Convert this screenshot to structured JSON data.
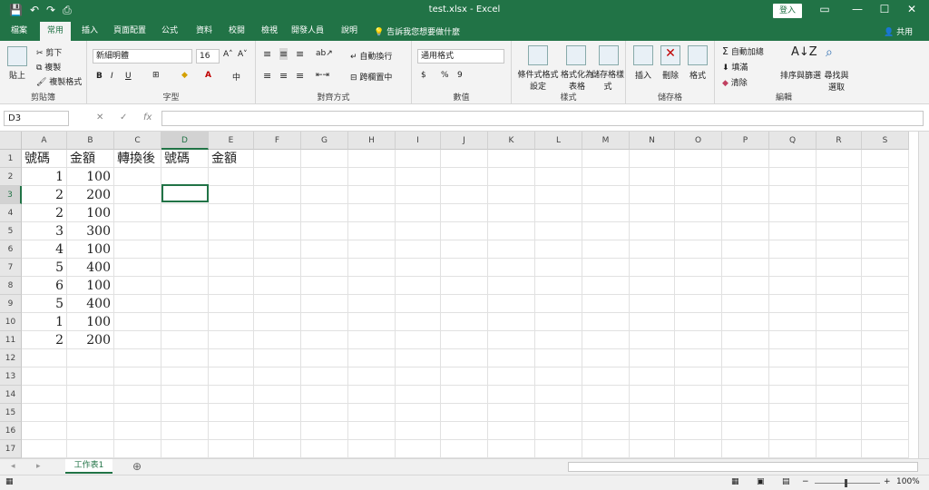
{
  "app": {
    "window_title": "test.xlsx  -  Excel",
    "sign_in": "登入",
    "tell_me": "告訴我您想要做什麼",
    "share": "共用",
    "colors": {
      "accent": "#217346",
      "ribbon_bg": "#f3f3f3"
    }
  },
  "tabs": [
    "檔案",
    "常用",
    "插入",
    "頁面配置",
    "公式",
    "資料",
    "校閱",
    "檢視",
    "開發人員",
    "說明"
  ],
  "active_tab": "常用",
  "ribbon": {
    "clipboard": {
      "label": "剪貼簿",
      "paste": "貼上",
      "cut": "剪下",
      "copy": "複製",
      "format_painter": "複製格式"
    },
    "font": {
      "label": "字型",
      "font_name": "新細明體",
      "font_size": "16",
      "bold": "B",
      "italic": "I",
      "underline": "U"
    },
    "alignment": {
      "label": "對齊方式",
      "wrap": "自動換行",
      "merge": "跨欄置中"
    },
    "number": {
      "label": "數值",
      "format": "通用格式",
      "currency": "$",
      "percent": "%",
      "comma": "9"
    },
    "styles": {
      "label": "樣式",
      "cond_format": "條件式格式設定",
      "format_table": "格式化為表格",
      "cell_styles": "儲存格樣式"
    },
    "cells": {
      "label": "儲存格",
      "insert": "插入",
      "delete": "刪除",
      "format": "格式"
    },
    "editing": {
      "label": "編輯",
      "autosum": "自動加總",
      "fill": "填滿",
      "clear": "清除",
      "sort": "排序與篩選",
      "find": "尋找與選取"
    }
  },
  "formula_bar": {
    "name_box": "D3",
    "fx": "fx",
    "content": ""
  },
  "columns": [
    "A",
    "B",
    "C",
    "D",
    "E",
    "F",
    "G",
    "H",
    "I",
    "J",
    "K",
    "L",
    "M",
    "N",
    "O",
    "P",
    "Q",
    "R",
    "S"
  ],
  "rows": [
    "1",
    "2",
    "3",
    "4",
    "5",
    "6",
    "7",
    "8",
    "9",
    "10",
    "11",
    "12",
    "13",
    "14",
    "15",
    "16",
    "17"
  ],
  "cells": [
    [
      "號碼",
      "金額",
      "轉換後",
      "號碼",
      "金額"
    ],
    [
      "1",
      "100",
      "",
      "",
      ""
    ],
    [
      "2",
      "200",
      "",
      "",
      ""
    ],
    [
      "2",
      "100",
      "",
      "",
      ""
    ],
    [
      "3",
      "300",
      "",
      "",
      ""
    ],
    [
      "4",
      "100",
      "",
      "",
      ""
    ],
    [
      "5",
      "400",
      "",
      "",
      ""
    ],
    [
      "6",
      "100",
      "",
      "",
      ""
    ],
    [
      "5",
      "400",
      "",
      "",
      ""
    ],
    [
      "1",
      "100",
      "",
      "",
      ""
    ],
    [
      "2",
      "200",
      "",
      "",
      ""
    ]
  ],
  "selected_cell": "D3",
  "sheet_tabs": [
    "工作表1"
  ],
  "status": {
    "zoom": "100%"
  }
}
